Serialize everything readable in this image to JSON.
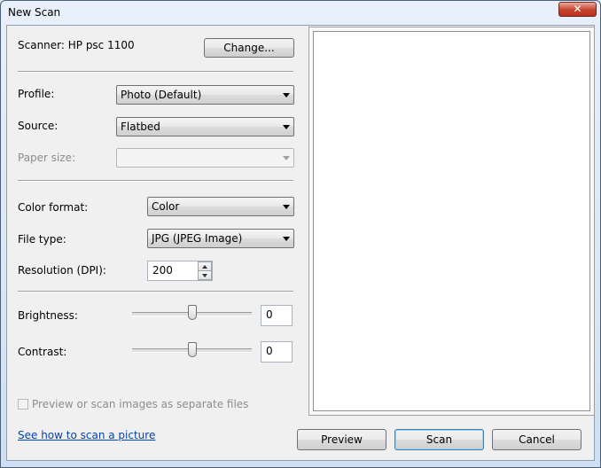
{
  "window": {
    "title": "New Scan",
    "close_glyph": "✕"
  },
  "scanner": {
    "label": "Scanner: HP psc 1100",
    "change_button": "Change..."
  },
  "profile": {
    "label": "Profile:",
    "value": "Photo (Default)"
  },
  "source": {
    "label": "Source:",
    "value": "Flatbed"
  },
  "paper_size": {
    "label": "Paper size:",
    "value": ""
  },
  "color_format": {
    "label": "Color format:",
    "value": "Color"
  },
  "file_type": {
    "label": "File type:",
    "value": "JPG (JPEG Image)"
  },
  "resolution": {
    "label": "Resolution (DPI):",
    "value": "200"
  },
  "brightness": {
    "label": "Brightness:",
    "value": "0"
  },
  "contrast": {
    "label": "Contrast:",
    "value": "0"
  },
  "separate_files": {
    "label": "Preview or scan images as separate files",
    "checked": false
  },
  "help_link": "See how to scan a picture",
  "buttons": {
    "preview": "Preview",
    "scan": "Scan",
    "cancel": "Cancel"
  }
}
